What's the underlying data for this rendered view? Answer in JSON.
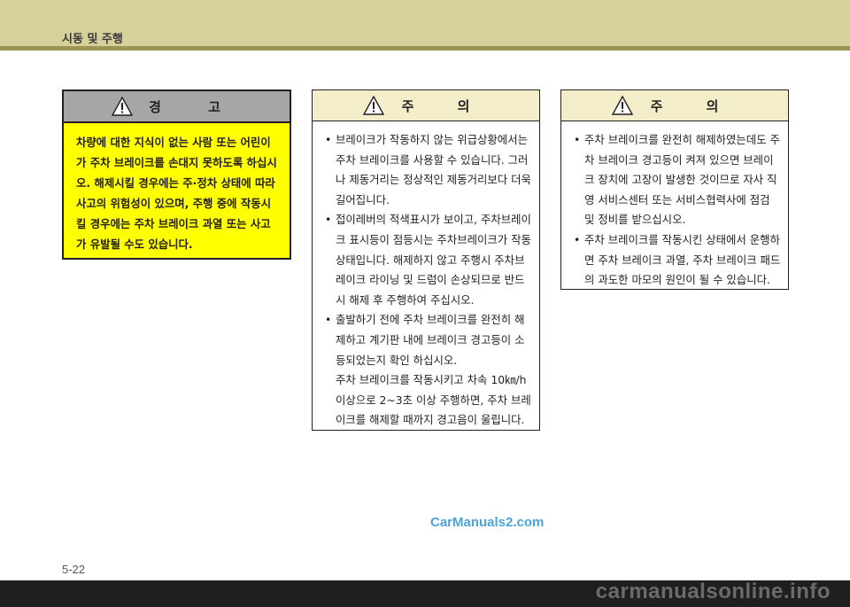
{
  "header": {
    "title": "시동 및 주행"
  },
  "warning": {
    "heading": "경 고",
    "text": "차량에 대한 지식이 없는 사람 또는 어린이가 주차 브레이크를 손대지 못하도록 하십시오. 해제시킬 경우에는 주·정차 상태에 따라 사고의 위험성이 있으며, 주행 중에 작동시킬 경우에는 주차 브레이크 과열 또는 사고가 유발될 수도 있습니다."
  },
  "caution1": {
    "heading": "주 의",
    "items": [
      {
        "text": "브레이크가 작동하지 않는 위급상황에서는 주차 브레이크를 사용할 수 있습니다. 그러나 제동거리는 정상적인 제동거리보다 더욱 길어집니다."
      },
      {
        "text": "접이레버의 적색표시가 보이고, 주차브레이크 표시등이 점등시는 주차브레이크가 작동상태입니다. 해제하지 않고 주행시 주차브레이크 라이닝 및 드럼이 손상되므로 반드시 해제 후 주행하여 주십시오."
      },
      {
        "text": "출발하기 전에 주차 브레이크를 완전히 해제하고 계기판 내에 브레이크 경고등이 소등되었는지 확인 하십시오.",
        "extra": "주차 브레이크를 작동시키고 차속 10㎞/h 이상으로 2~3초 이상 주행하면, 주차 브레이크를 해제할 때까지 경고음이 울립니다."
      }
    ]
  },
  "caution2": {
    "heading": "주 의",
    "items": [
      {
        "text": "주차 브레이크를 완전히 해제하였는데도 주차 브레이크 경고등이 켜져 있으면 브레이크 장치에 고장이 발생한 것이므로 자사 직영 서비스센터 또는 서비스협력사에 점검 및 정비를 받으십시오."
      },
      {
        "text": "주차 브레이크를 작동시킨 상태에서 운행하면 주차 브레이크 과열, 주차 브레이크 패드의 과도한 마모의 원인이 될 수 있습니다."
      }
    ]
  },
  "watermark": "CarManuals2.com",
  "page_number": "5-22",
  "footer_watermark": "carmanualsonline.info",
  "icons": {
    "warning": "warning-triangle-icon",
    "caution": "warning-triangle-icon"
  },
  "colors": {
    "header": "#d6d19a",
    "warning_box": "#ffff00",
    "warning_head": "#a6a6a6",
    "caution_head": "#f4edc9"
  }
}
